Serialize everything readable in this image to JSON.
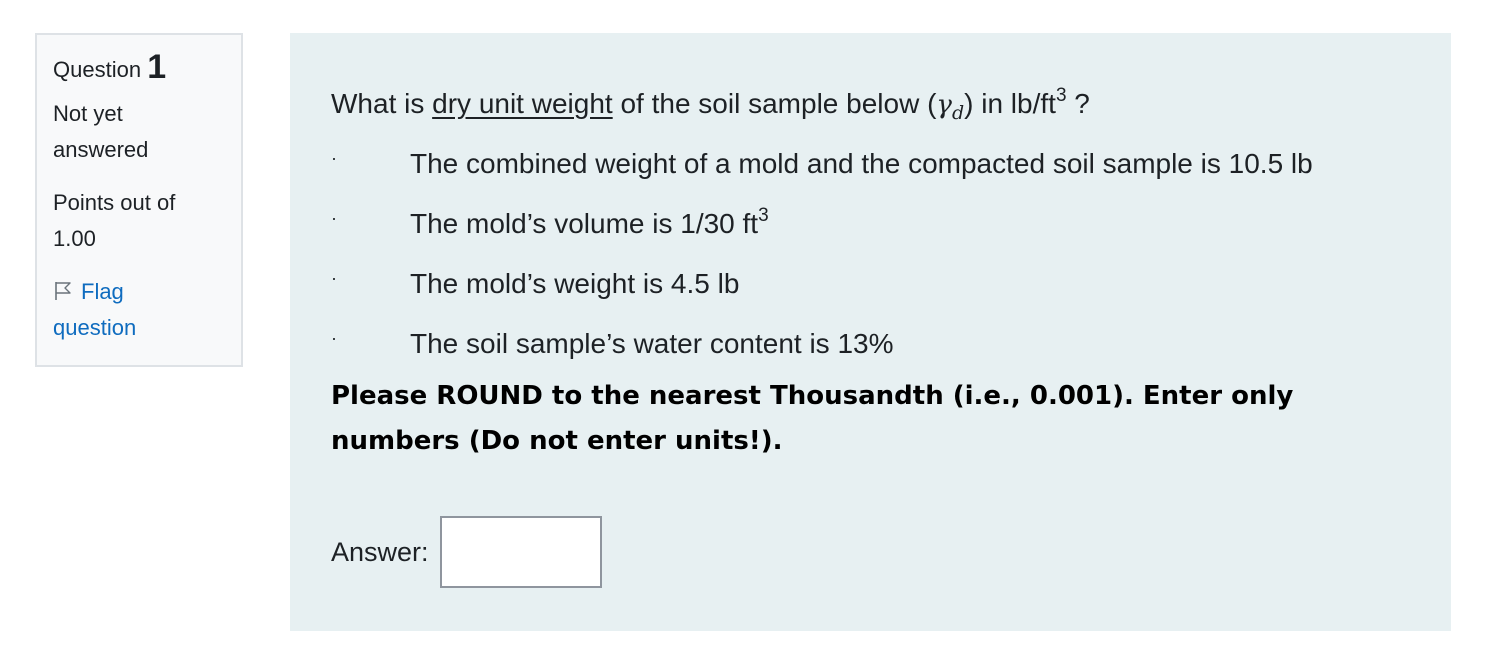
{
  "info": {
    "question_label": "Question",
    "question_number": "1",
    "state_line1": "Not yet",
    "state_line2": "answered",
    "grade_line1": "Points out of",
    "grade_line2": "1.00",
    "flag_line1": "Flag",
    "flag_line2": "question"
  },
  "question": {
    "prefix": "What is ",
    "underlined": "dry unit weight",
    "middle": " of the soil sample below (",
    "symbol": "γ",
    "symbol_sub": "d",
    "after_symbol": ") in lb/ft",
    "unit_exp": "3",
    "suffix": " ?"
  },
  "bullets": [
    {
      "bullet": "·",
      "text": "The combined weight of a mold and the compacted soil sample is 10.5 lb",
      "sup": ""
    },
    {
      "bullet": "·",
      "text": "The mold’s volume is 1/30 ft",
      "sup": "3"
    },
    {
      "bullet": "·",
      "text": "The mold’s weight is 4.5 lb",
      "sup": ""
    },
    {
      "bullet": "·",
      "text": "The soil sample’s water content is 13%",
      "sup": ""
    }
  ],
  "note": {
    "line1": "Please ROUND to the nearest Thousandth (i.e., 0.001). Enter only",
    "line2": "numbers (Do not enter units!)."
  },
  "answer": {
    "label": "Answer:",
    "value": ""
  },
  "icons": {
    "flag": "flag-icon"
  },
  "colors": {
    "info_bg": "#f8f9fa",
    "info_border": "#dee2e6",
    "content_bg": "#e7f0f2",
    "link": "#0f6cbf",
    "text": "#1d2125"
  }
}
